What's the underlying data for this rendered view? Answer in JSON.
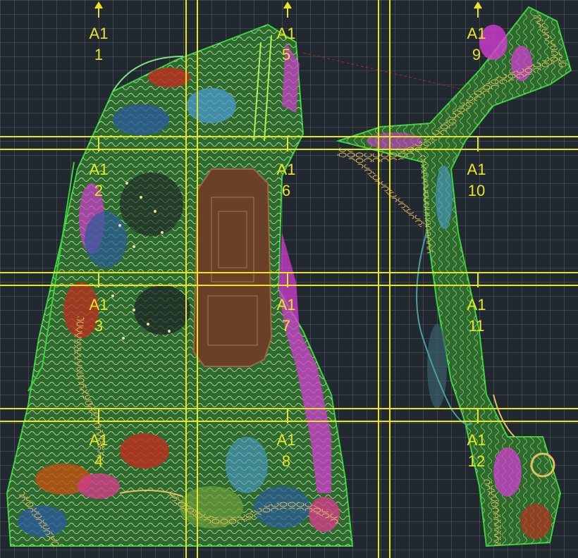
{
  "title": "",
  "sheets": [
    {
      "code": "A1",
      "num": "1"
    },
    {
      "code": "A1",
      "num": "2"
    },
    {
      "code": "A1",
      "num": "3"
    },
    {
      "code": "A1",
      "num": "4"
    },
    {
      "code": "A1",
      "num": "5"
    },
    {
      "code": "A1",
      "num": "6"
    },
    {
      "code": "A1",
      "num": "7"
    },
    {
      "code": "A1",
      "num": "8"
    },
    {
      "code": "A1",
      "num": "9"
    },
    {
      "code": "A1",
      "num": "10"
    },
    {
      "code": "A1",
      "num": "11"
    },
    {
      "code": "A1",
      "num": "12"
    }
  ],
  "colors": {
    "background": "#212830",
    "grid": "#9aa4ae",
    "match_lines": "#e8e620",
    "boundary": "#3cd23c",
    "path": "#d9a84a",
    "planting_magenta": "#d23cd2",
    "planting_blue": "#2a5a9a",
    "planting_red": "#b83020",
    "court": "#7a4a2a",
    "contours": "#e8f0e8"
  }
}
